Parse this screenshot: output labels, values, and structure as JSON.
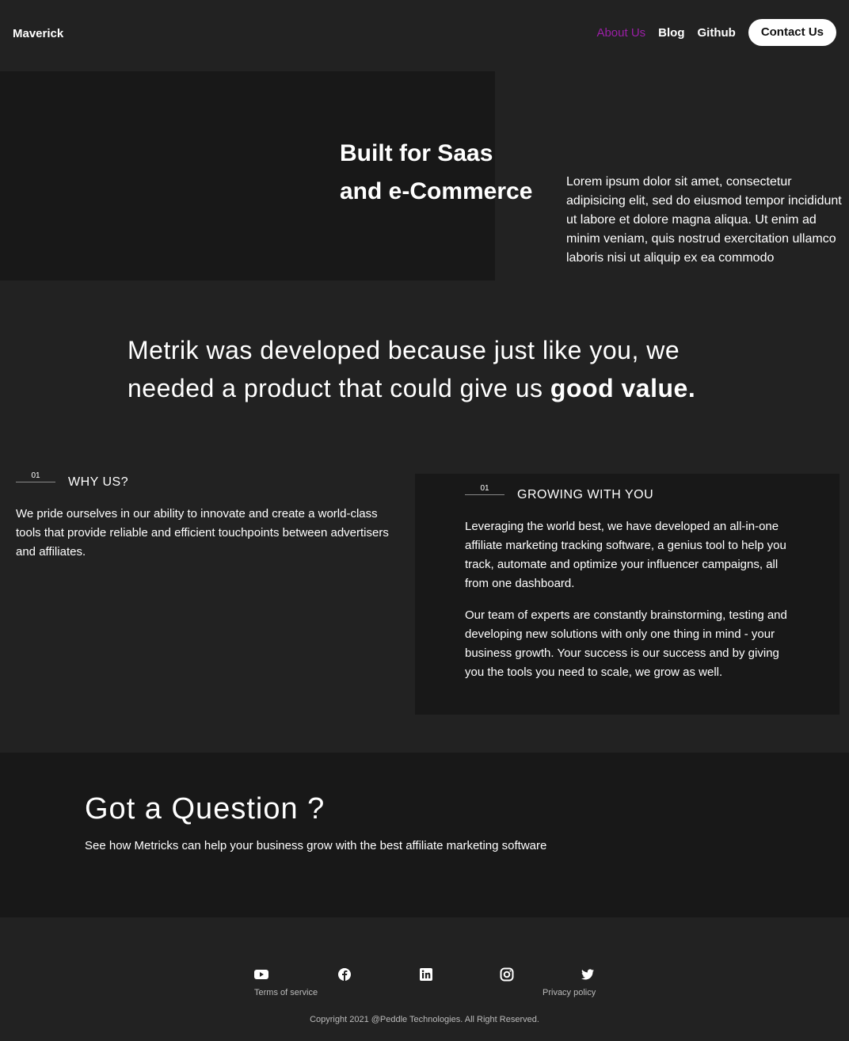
{
  "header": {
    "brand": "Maverick",
    "nav": [
      {
        "label": "About Us"
      },
      {
        "label": "Blog"
      },
      {
        "label": "Github"
      }
    ],
    "contact_label": "Contact Us",
    "accent_color": "#9b1fa6"
  },
  "hero": {
    "title_line1": "Built for Saas",
    "title_line2": "and e-Commerce",
    "text": "Lorem ipsum dolor sit amet, consectetur adipisicing elit, sed do eiusmod tempor incididunt ut labore et dolore magna aliqua. Ut enim ad minim veniam, quis nostrud exercitation ullamco laboris nisi ut aliquip ex ea commodo"
  },
  "statement": {
    "text": "Metrik was developed because just like you, we needed a product that could give us ",
    "emphasis": "good value."
  },
  "features": [
    {
      "number": "01",
      "title": "WHY US?",
      "paragraphs": [
        "We pride ourselves in our ability to innovate and create a world-class tools that provide reliable and efficient touchpoints between advertisers and affiliates."
      ]
    },
    {
      "number": "01",
      "title": "GROWING WITH YOU",
      "paragraphs": [
        "Leveraging the world best, we have developed an all-in-one affiliate marketing tracking software, a genius tool to help you track, automate and optimize your influencer campaigns, all from one dashboard.",
        "Our team of experts are constantly brainstorming, testing and developing new solutions with only one thing in mind - your business growth. Your success is our success and by giving you the tools you need to scale, we grow as well."
      ]
    }
  ],
  "question": {
    "title": "Got a Question ?",
    "text": "See how Metricks can help your business grow with the best affiliate marketing software"
  },
  "footer": {
    "icons": [
      "youtube-icon",
      "facebook-icon",
      "linkedin-icon",
      "instagram-icon",
      "twitter-icon"
    ],
    "terms": "Terms of service",
    "privacy": "Privacy policy",
    "copyright": "Copyright 2021 @Peddle Technologies. All Right Reserved."
  }
}
